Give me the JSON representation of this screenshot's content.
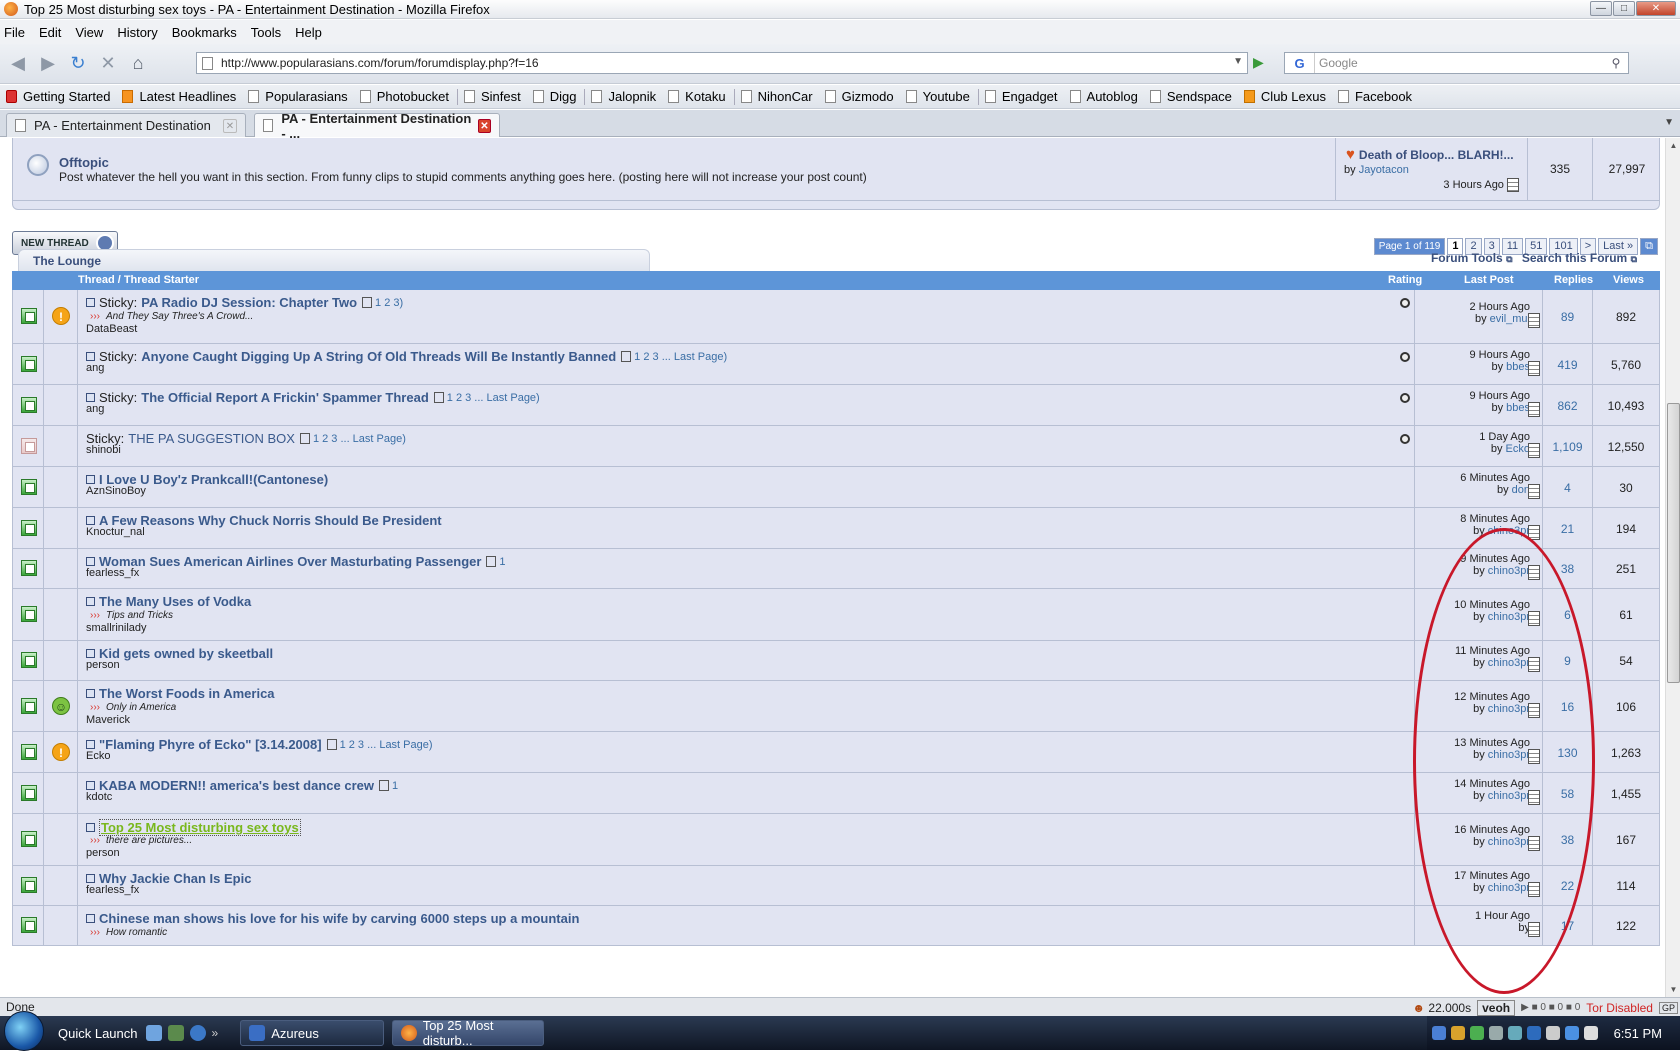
{
  "window": {
    "title": "Top 25 Most disturbing sex toys - PA - Entertainment Destination - Mozilla Firefox"
  },
  "menu": [
    "File",
    "Edit",
    "View",
    "History",
    "Bookmarks",
    "Tools",
    "Help"
  ],
  "nav": {
    "url": "http://www.popularasians.com/forum/forumdisplay.php?f=16",
    "search_placeholder": "Google"
  },
  "bookmarks": [
    {
      "label": "Getting Started",
      "icon": "red"
    },
    {
      "label": "Latest Headlines",
      "icon": "rss"
    },
    {
      "label": "Popularasians",
      "icon": "page"
    },
    {
      "label": "Photobucket",
      "icon": "page"
    },
    {
      "label": "Sinfest",
      "icon": "page"
    },
    {
      "label": "Digg",
      "icon": "page"
    },
    {
      "label": "Jalopnik",
      "icon": "page"
    },
    {
      "label": "Kotaku",
      "icon": "page"
    },
    {
      "label": "NihonCar",
      "icon": "page"
    },
    {
      "label": "Gizmodo",
      "icon": "page"
    },
    {
      "label": "Youtube",
      "icon": "page"
    },
    {
      "label": "Engadget",
      "icon": "page"
    },
    {
      "label": "Autoblog",
      "icon": "page"
    },
    {
      "label": "Sendspace",
      "icon": "page"
    },
    {
      "label": "Club Lexus",
      "icon": "lexus"
    },
    {
      "label": "Facebook",
      "icon": "page"
    }
  ],
  "tabs": [
    "PA - Entertainment Destination",
    "PA - Entertainment Destination - ..."
  ],
  "forum": {
    "name": "Offtopic",
    "desc": "Post whatever the hell you want in this section. From funny clips to stupid comments anything goes here. (posting here will not increase your post count)",
    "last_title": "Death of Bloop... BLARH!...",
    "last_by_prefix": "by",
    "last_by": "Jayotacon",
    "last_time": "3 Hours Ago",
    "threads": "335",
    "posts": "27,997"
  },
  "new_thread_label": "NEW THREAD",
  "pagenav": {
    "page_of": "Page 1 of 119",
    "pages": [
      "1",
      "2",
      "3",
      "11",
      "51",
      "101",
      ">",
      "Last »"
    ]
  },
  "section_title": "The Lounge",
  "forum_tools": "Forum Tools",
  "search_forum": "Search this Forum",
  "headers": {
    "thread": "Thread / Thread Starter",
    "rating": "Rating",
    "last_post": "Last Post",
    "replies": "Replies",
    "views": "Views"
  },
  "rows": [
    {
      "prefix": "Sticky:",
      "title": "PA Radio DJ Session: Chapter Two",
      "pages": "1 2 3)",
      "sub": "And They Say Three's A Crowd...",
      "author": "DataBeast",
      "time": "2 Hours Ago",
      "by": "evil_mui",
      "replies": "89",
      "views": "892",
      "rating": true
    },
    {
      "prefix": "Sticky:",
      "title": "Anyone Caught Digging Up A String Of Old Threads Will Be Instantly Banned",
      "pages": "1 2 3 ... Last Page)",
      "sub": "",
      "author": "ang",
      "time": "9 Hours Ago",
      "by": "bbes",
      "replies": "419",
      "views": "5,760",
      "rating": true
    },
    {
      "prefix": "Sticky:",
      "title": "The Official Report A Frickin' Spammer Thread",
      "pages": "1 2 3 ... Last Page)",
      "sub": "",
      "author": "ang",
      "time": "9 Hours Ago",
      "by": "bbes",
      "replies": "862",
      "views": "10,493",
      "rating": true
    },
    {
      "prefix": "Sticky:",
      "title": "THE PA SUGGESTION BOX",
      "pages": "1 2 3 ... Last Page)",
      "sub": "",
      "author": "shinobi",
      "time": "1 Day Ago",
      "by": "Ecko",
      "replies": "1,109",
      "views": "12,550",
      "rating": true
    },
    {
      "prefix": "",
      "title": "I Love U Boy'z Prankcall!(Cantonese)",
      "pages": "",
      "sub": "",
      "author": "AznSinoBoy",
      "time": "6 Minutes Ago",
      "by": "don",
      "replies": "4",
      "views": "30",
      "rating": false
    },
    {
      "prefix": "",
      "title": "A Few Reasons Why Chuck Norris Should Be President",
      "pages": "",
      "sub": "",
      "author": "Knoctur_nal",
      "time": "8 Minutes Ago",
      "by": "chino3pr",
      "replies": "21",
      "views": "194",
      "rating": false
    },
    {
      "prefix": "",
      "title": "Woman Sues American Airlines Over Masturbating Passenger",
      "pages": "1",
      "sub": "",
      "author": "fearless_fx",
      "time": "9 Minutes Ago",
      "by": "chino3pr",
      "replies": "38",
      "views": "251",
      "rating": false
    },
    {
      "prefix": "",
      "title": "The Many Uses of Vodka",
      "pages": "",
      "sub": "Tips and Tricks",
      "author": "smallrinilady",
      "time": "10 Minutes Ago",
      "by": "chino3pr",
      "replies": "6",
      "views": "61",
      "rating": false
    },
    {
      "prefix": "",
      "title": "Kid gets owned by skeetball",
      "pages": "",
      "sub": "",
      "author": "person",
      "time": "11 Minutes Ago",
      "by": "chino3pr",
      "replies": "9",
      "views": "54",
      "rating": false
    },
    {
      "prefix": "",
      "title": "The Worst Foods in America",
      "pages": "",
      "sub": "Only in America",
      "author": "Maverick",
      "time": "12 Minutes Ago",
      "by": "chino3pr",
      "replies": "16",
      "views": "106",
      "rating": false
    },
    {
      "prefix": "",
      "title": "\"Flaming Phyre of Ecko\" [3.14.2008]",
      "pages": "1 2 3 ... Last Page)",
      "sub": "",
      "author": "Ecko",
      "time": "13 Minutes Ago",
      "by": "chino3pr",
      "replies": "130",
      "views": "1,263",
      "rating": false
    },
    {
      "prefix": "",
      "title": "KABA MODERN!! america's best dance crew",
      "pages": "1",
      "sub": "",
      "author": "kdotc",
      "time": "14 Minutes Ago",
      "by": "chino3pr",
      "replies": "58",
      "views": "1,455",
      "rating": false
    },
    {
      "prefix": "",
      "title": "Top 25 Most disturbing sex toys",
      "pages": "",
      "sub": "there are pictures...",
      "author": "person",
      "time": "16 Minutes Ago",
      "by": "chino3pr",
      "replies": "38",
      "views": "167",
      "rating": false
    },
    {
      "prefix": "",
      "title": "Why Jackie Chan Is Epic",
      "pages": "",
      "sub": "",
      "author": "fearless_fx",
      "time": "17 Minutes Ago",
      "by": "chino3pr",
      "replies": "22",
      "views": "114",
      "rating": false
    },
    {
      "prefix": "",
      "title": "Chinese man shows his love for his wife by carving 6000 steps up a mountain",
      "pages": "",
      "sub": "How romantic",
      "author": "",
      "time": "1 Hour Ago",
      "by": "",
      "replies": "17",
      "views": "122",
      "rating": false
    }
  ],
  "status": {
    "text": "Done",
    "timer": "22.000s",
    "veoh": "veoh",
    "tor": "Tor Disabled"
  },
  "taskbar": {
    "quick_launch": "Quick Launch",
    "azureus": "Azureus",
    "firefox": "Top 25 Most disturb...",
    "clock": "6:51 PM"
  }
}
